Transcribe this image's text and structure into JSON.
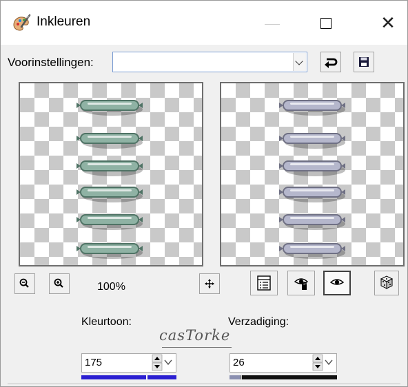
{
  "window": {
    "title": "Inkleuren"
  },
  "titlebar_icons": {
    "app": "palette-brush-icon",
    "minimize": "minimize-icon",
    "maximize": "maximize-icon",
    "close": "close-icon"
  },
  "close_glyph": "✕",
  "presets": {
    "label": "Voorinstellingen:",
    "value": "",
    "dropdown_icon": "chevron-down-icon",
    "reset_icon": "undo-arrow-icon",
    "save_icon": "save-floppy-icon"
  },
  "zoom": {
    "out_icon": "zoom-out-icon",
    "in_icon": "zoom-in-icon",
    "level": "100%",
    "move_icon": "move-cross-icon"
  },
  "view_buttons": {
    "toggle_icon": "list-view-icon",
    "auto_proof_icon": "eye-auto-icon",
    "proof_icon": "eye-icon",
    "randomize_icon": "dice-icon"
  },
  "hue": {
    "label": "Kleurtoon:",
    "value": "175",
    "bar_color": "#2b1fd1",
    "bar_level_percent": 68
  },
  "saturation": {
    "label": "Verzadiging:",
    "value": "26",
    "bar_color": "#101010",
    "bar_level_percent": 10
  },
  "watermark": "casTorke",
  "colors": {
    "original_ring": "#8fb2a4",
    "original_ring_shadow": "#4f7365",
    "result_ring": "#b5b7cc",
    "result_ring_shadow": "#6f7084"
  }
}
